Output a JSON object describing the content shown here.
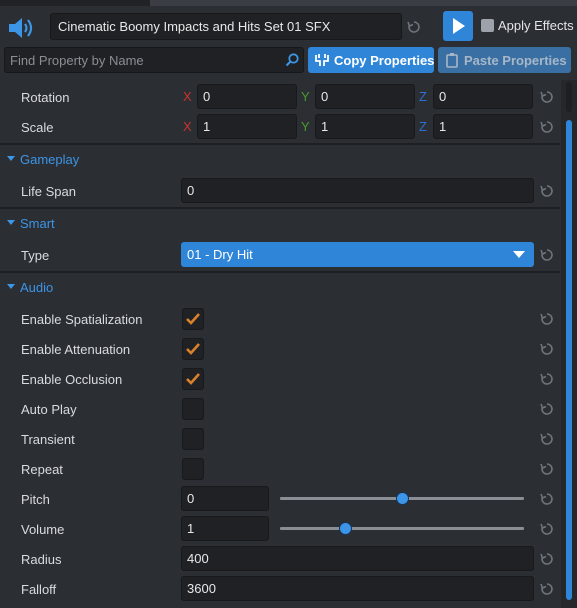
{
  "header": {
    "asset_name": "Cinematic Boomy Impacts and Hits Set 01 SFX",
    "apply_effects_label": "Apply Effects",
    "apply_effects_checked": false
  },
  "toolbar": {
    "search_placeholder": "Find Property by Name",
    "copy_label": "Copy Properties",
    "paste_label": "Paste Properties"
  },
  "transform": {
    "rotation": {
      "label": "Rotation",
      "x": "0",
      "y": "0",
      "z": "0"
    },
    "scale": {
      "label": "Scale",
      "x": "1",
      "y": "1",
      "z": "1"
    },
    "axis_labels": {
      "x": "X",
      "y": "Y",
      "z": "Z"
    }
  },
  "gameplay": {
    "title": "Gameplay",
    "life_span_label": "Life Span",
    "life_span_value": "0"
  },
  "smart": {
    "title": "Smart",
    "type_label": "Type",
    "type_value": "01 - Dry Hit"
  },
  "audio": {
    "title": "Audio",
    "enable_spatialization": {
      "label": "Enable Spatialization",
      "checked": true
    },
    "enable_attenuation": {
      "label": "Enable Attenuation",
      "checked": true
    },
    "enable_occlusion": {
      "label": "Enable Occlusion",
      "checked": true
    },
    "auto_play": {
      "label": "Auto Play",
      "checked": false
    },
    "transient": {
      "label": "Transient",
      "checked": false
    },
    "repeat": {
      "label": "Repeat",
      "checked": false
    },
    "pitch": {
      "label": "Pitch",
      "value": "0",
      "slider_fraction": 0.5
    },
    "volume": {
      "label": "Volume",
      "value": "1",
      "slider_fraction": 0.27
    },
    "radius": {
      "label": "Radius",
      "value": "400"
    },
    "falloff": {
      "label": "Falloff",
      "value": "3600"
    }
  },
  "colors": {
    "accent": "#2f86d9",
    "section_title": "#3c95e6",
    "check_mark": "#d9822b",
    "axis_x": "#c8352d",
    "axis_y": "#4a9a31",
    "axis_z": "#2f6fd0"
  },
  "icons": {
    "speaker": "speaker-icon",
    "reset": "reset-icon",
    "play": "play-icon",
    "search": "search-icon",
    "copy": "copy-icon",
    "paste": "paste-icon",
    "checkmark": "checkmark-icon"
  }
}
